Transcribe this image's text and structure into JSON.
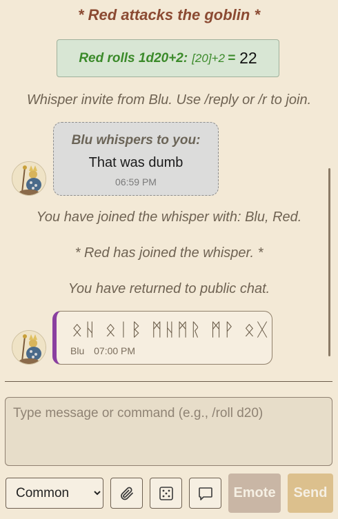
{
  "chat": {
    "action_line": "* Red attacks the goblin *",
    "roll": {
      "label": "Red rolls 1d20+2:",
      "detail": "[20]+2",
      "equals": "=",
      "result": "22"
    },
    "whisper_invite": "Whisper invite from Blu. Use /reply or /r to join.",
    "whisper_message": {
      "header": "Blu whispers to you:",
      "text": "That was dumb",
      "time": "06:59 PM"
    },
    "joined_with": "You have joined the whisper with: Blu, Red.",
    "red_joined": "* Red has joined the whisper. *",
    "returned": "You have returned to public chat.",
    "rune_message": {
      "text": "ᛟᚺ ᛟᛁᛒ ᛗᚺᛗᚱ ᛗᚹ ᛟᚷ",
      "sender": "Blu",
      "time": "07:00 PM"
    }
  },
  "composer": {
    "placeholder": "Type message or command (e.g., /roll d20)",
    "language_selected": "Common",
    "emote_label": "Emote",
    "send_label": "Send"
  },
  "icons": {
    "attach": "paperclip-icon",
    "dice": "dice-icon",
    "whisper": "speech-bubble-icon"
  },
  "colors": {
    "background": "#f3e9d6",
    "action_text": "#8b4a32",
    "roll_green": "#3b8a2a",
    "rune_accent": "#8a3fa0",
    "emote_button": "#c9b6a5",
    "send_button": "#dcc08d"
  }
}
